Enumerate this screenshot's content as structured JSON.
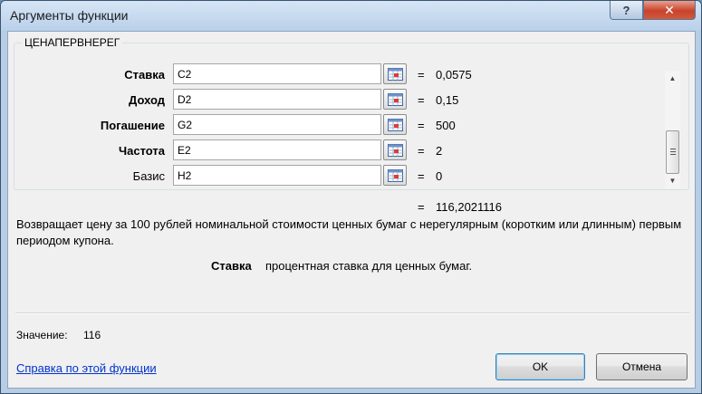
{
  "window": {
    "title": "Аргументы функции",
    "help_button": "?",
    "close_button": "✕"
  },
  "function": {
    "name": "ЦЕНАПЕРВНЕРЕГ",
    "arguments": [
      {
        "label": "Ставка",
        "input": "C2",
        "equals": "=",
        "value": "0,0575",
        "bold": true
      },
      {
        "label": "Доход",
        "input": "D2",
        "equals": "=",
        "value": "0,15",
        "bold": true
      },
      {
        "label": "Погашение",
        "input": "G2",
        "equals": "=",
        "value": "500",
        "bold": true
      },
      {
        "label": "Частота",
        "input": "E2",
        "equals": "=",
        "value": "2",
        "bold": true
      },
      {
        "label": "Базис",
        "input": "H2",
        "equals": "=",
        "value": "0",
        "bold": false
      }
    ],
    "result_equals": "=",
    "result_value": "116,2021116",
    "description": "Возвращает цену за 100 рублей номинальной стоимости ценных бумаг с нерегулярным (коротким или длинным) первым периодом купона.",
    "current_arg_name": "Ставка",
    "current_arg_help": "процентная ставка для ценных бумаг."
  },
  "footer": {
    "value_label": "Значение:",
    "value": "116",
    "help_link": "Справка по этой функции",
    "ok_label": "OK",
    "cancel_label": "Отмена"
  },
  "colors": {
    "link": "#0033cc",
    "close_button": "#c7432b"
  }
}
